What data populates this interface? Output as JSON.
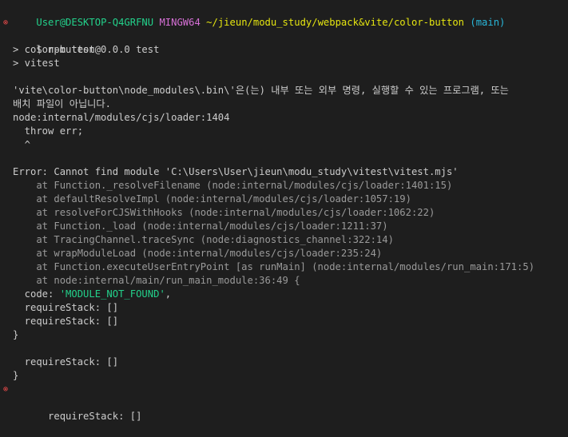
{
  "prompt": {
    "user_host": "User@DESKTOP-Q4GRFNU",
    "shell": "MINGW64",
    "path": "~/jieun/modu_study/webpack&vite/color-button",
    "branch": "(main)"
  },
  "command": "$ npm test",
  "npm_script": {
    "line1": "> color-button@0.0.0 test",
    "line2": "> vitest"
  },
  "error_message": {
    "line1": "'vite\\color-button\\node_modules\\.bin\\'은(는) 내부 또는 외부 명령, 실행할 수 있는 프로그램, 또는",
    "line2": "배치 파일이 아닙니다."
  },
  "node_error": {
    "location": "node:internal/modules/cjs/loader:1404",
    "throw_line": "  throw err;",
    "caret": "  ^",
    "error_line": "Error: Cannot find module 'C:\\Users\\User\\jieun\\modu_study\\vitest\\vitest.mjs'",
    "stack": [
      "    at Function._resolveFilename (node:internal/modules/cjs/loader:1401:15)",
      "    at defaultResolveImpl (node:internal/modules/cjs/loader:1057:19)",
      "    at resolveForCJSWithHooks (node:internal/modules/cjs/loader:1062:22)",
      "    at Function._load (node:internal/modules/cjs/loader:1211:37)",
      "    at TracingChannel.traceSync (node:diagnostics_channel:322:14)",
      "    at wrapModuleLoad (node:internal/modules/cjs/loader:235:24)",
      "    at Function.executeUserEntryPoint [as runMain] (node:internal/modules/run_main:171:5)",
      "    at node:internal/main/run_main_module:36:49 {"
    ],
    "code_key": "  code: ",
    "code_value": "'MODULE_NOT_FOUND'",
    "code_comma": ",",
    "require_stack_1": "  requireStack: []",
    "require_stack_2": "  requireStack: []",
    "close_brace_1": "}",
    "require_stack_3": "  requireStack: []",
    "close_brace_2": "}",
    "require_stack_4": "  requireStack: []"
  },
  "markers": {
    "error_symbol": "⊗"
  },
  "colors": {
    "background": "#1e1e1e",
    "foreground": "#cccccc",
    "user_host": "#23d18b",
    "shell": "#d670d6",
    "path": "#e5e510",
    "branch": "#29b8db",
    "string": "#23d18b",
    "error_marker": "#f14c4c"
  }
}
